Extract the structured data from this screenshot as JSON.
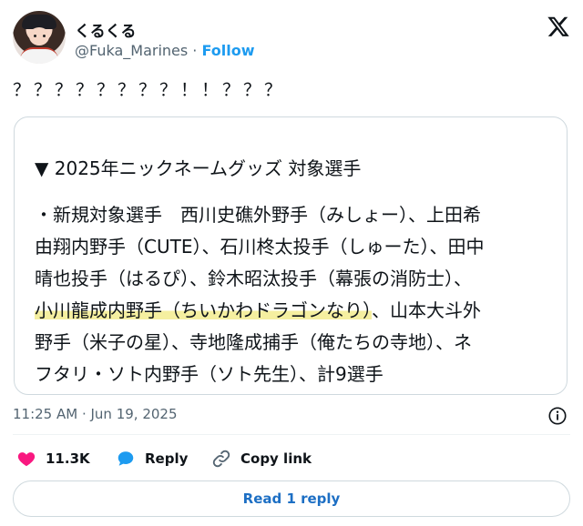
{
  "user": {
    "display_name": "くるくる",
    "handle": "@Fuka_Marines",
    "separator": " · ",
    "follow_label": "Follow"
  },
  "tweet": {
    "text": "？？？？？？？？！！？？？",
    "card": {
      "title": "▼ 2025年ニックネームグッズ 対象選手",
      "lines": [
        "・新規対象選手　西川史礁外野手（みしょー）、上田希",
        "由翔内野手（CUTE）、石川柊太投手（しゅーた）、田中",
        "晴也投手（はるぴ）、鈴木昭汰投手（幕張の消防士）、",
        "、山本大斗外",
        "野手（米子の星）、寺地隆成捕手（俺たちの寺地）、ネ",
        "フタリ・ソト内野手（ソト先生）、計9選手"
      ],
      "highlight": "小川龍成内野手（ちいかわドラゴンなり）"
    },
    "timestamp": "11:25 AM · Jun 19, 2025"
  },
  "actions": {
    "like_count": "11.3K",
    "reply_label": "Reply",
    "copy_label": "Copy link"
  },
  "read_reply_label": "Read 1 reply",
  "colors": {
    "accent": "#1d9bf0",
    "like": "#f91880",
    "highlight": "#f5efa0",
    "muted": "#536471"
  },
  "icons": [
    "x-logo-icon",
    "info-icon",
    "heart-icon",
    "reply-bubble-icon",
    "link-icon"
  ]
}
